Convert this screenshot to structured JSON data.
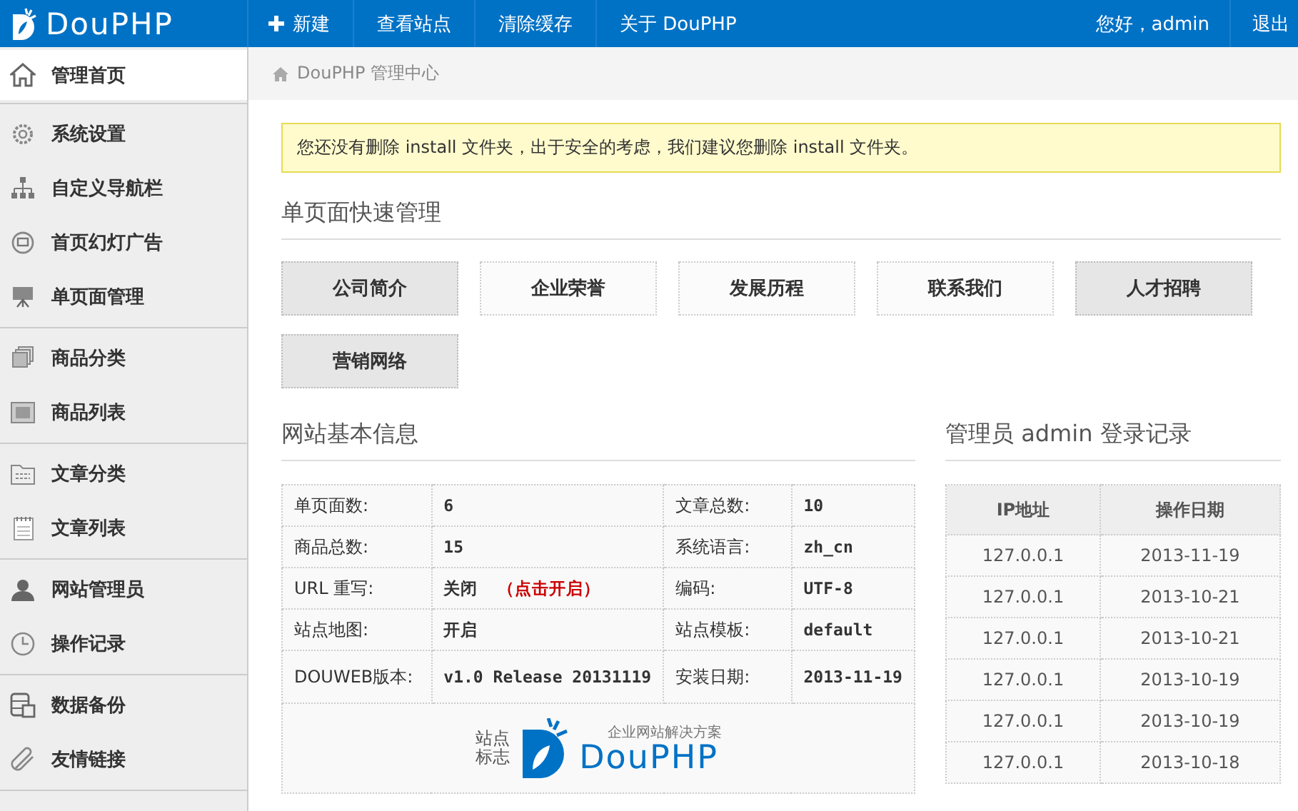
{
  "header": {
    "logo": "DouPHP",
    "nav": [
      {
        "label": "新建",
        "kind": "add"
      },
      {
        "label": "查看站点",
        "kind": "plain"
      },
      {
        "label": "清除缓存",
        "kind": "plain"
      },
      {
        "label": "关于 DouPHP",
        "kind": "plain"
      }
    ],
    "greeting": "您好，admin",
    "logout": "退出"
  },
  "sidebar": {
    "groups": [
      {
        "items": [
          {
            "label": "管理首页",
            "selected": true
          }
        ]
      },
      {
        "items": [
          {
            "label": "系统设置",
            "selected": false
          },
          {
            "label": "自定义导航栏",
            "selected": false
          },
          {
            "label": "首页幻灯广告",
            "selected": false
          },
          {
            "label": "单页面管理",
            "selected": false
          }
        ]
      },
      {
        "items": [
          {
            "label": "商品分类",
            "selected": false
          },
          {
            "label": "商品列表",
            "selected": false
          }
        ]
      },
      {
        "items": [
          {
            "label": "文章分类",
            "selected": false
          },
          {
            "label": "文章列表",
            "selected": false
          }
        ]
      },
      {
        "items": [
          {
            "label": "网站管理员",
            "selected": false
          },
          {
            "label": "操作记录",
            "selected": false
          }
        ]
      },
      {
        "items": [
          {
            "label": "数据备份",
            "selected": false
          },
          {
            "label": "友情链接",
            "selected": false
          }
        ]
      }
    ]
  },
  "breadcrumb": "DouPHP 管理中心",
  "alert": "您还没有删除 install 文件夹，出于安全的考虑，我们建议您删除 install 文件夹。",
  "quick_pages": {
    "title": "单页面快速管理",
    "buttons": [
      {
        "label": "公司简介",
        "shaded": true
      },
      {
        "label": "企业荣誉",
        "shaded": false
      },
      {
        "label": "发展历程",
        "shaded": false
      },
      {
        "label": "联系我们",
        "shaded": false
      },
      {
        "label": "人才招聘",
        "shaded": true
      },
      {
        "label": "营销网络",
        "shaded": true
      }
    ]
  },
  "site_info": {
    "title": "网站基本信息",
    "rows": [
      [
        {
          "label": "单页面数:",
          "value": "6"
        },
        {
          "label": "文章总数:",
          "value": "10"
        }
      ],
      [
        {
          "label": "商品总数:",
          "value": "15"
        },
        {
          "label": "系统语言:",
          "value": "zh_cn"
        }
      ],
      [
        {
          "label": "URL 重写:",
          "value": "关闭",
          "link": "（点击开启）"
        },
        {
          "label": "编码:",
          "value": "UTF-8"
        }
      ],
      [
        {
          "label": "站点地图:",
          "value": "开启"
        },
        {
          "label": "站点模板:",
          "value": "default"
        }
      ],
      [
        {
          "label": "DOUWEB版本:",
          "value": "v1.0 Release 20131119"
        },
        {
          "label": "安装日期:",
          "value": "2013-11-19"
        }
      ]
    ],
    "logo_label": "站点标志",
    "logo_tagline": "企业网站解决方案",
    "logo_name": "DouPHP"
  },
  "login_log": {
    "title": "管理员 admin 登录记录",
    "columns": [
      "IP地址",
      "操作日期"
    ],
    "rows": [
      [
        "127.0.0.1",
        "2013-11-19"
      ],
      [
        "127.0.0.1",
        "2013-10-21"
      ],
      [
        "127.0.0.1",
        "2013-10-21"
      ],
      [
        "127.0.0.1",
        "2013-10-19"
      ],
      [
        "127.0.0.1",
        "2013-10-19"
      ],
      [
        "127.0.0.1",
        "2013-10-18"
      ]
    ]
  }
}
